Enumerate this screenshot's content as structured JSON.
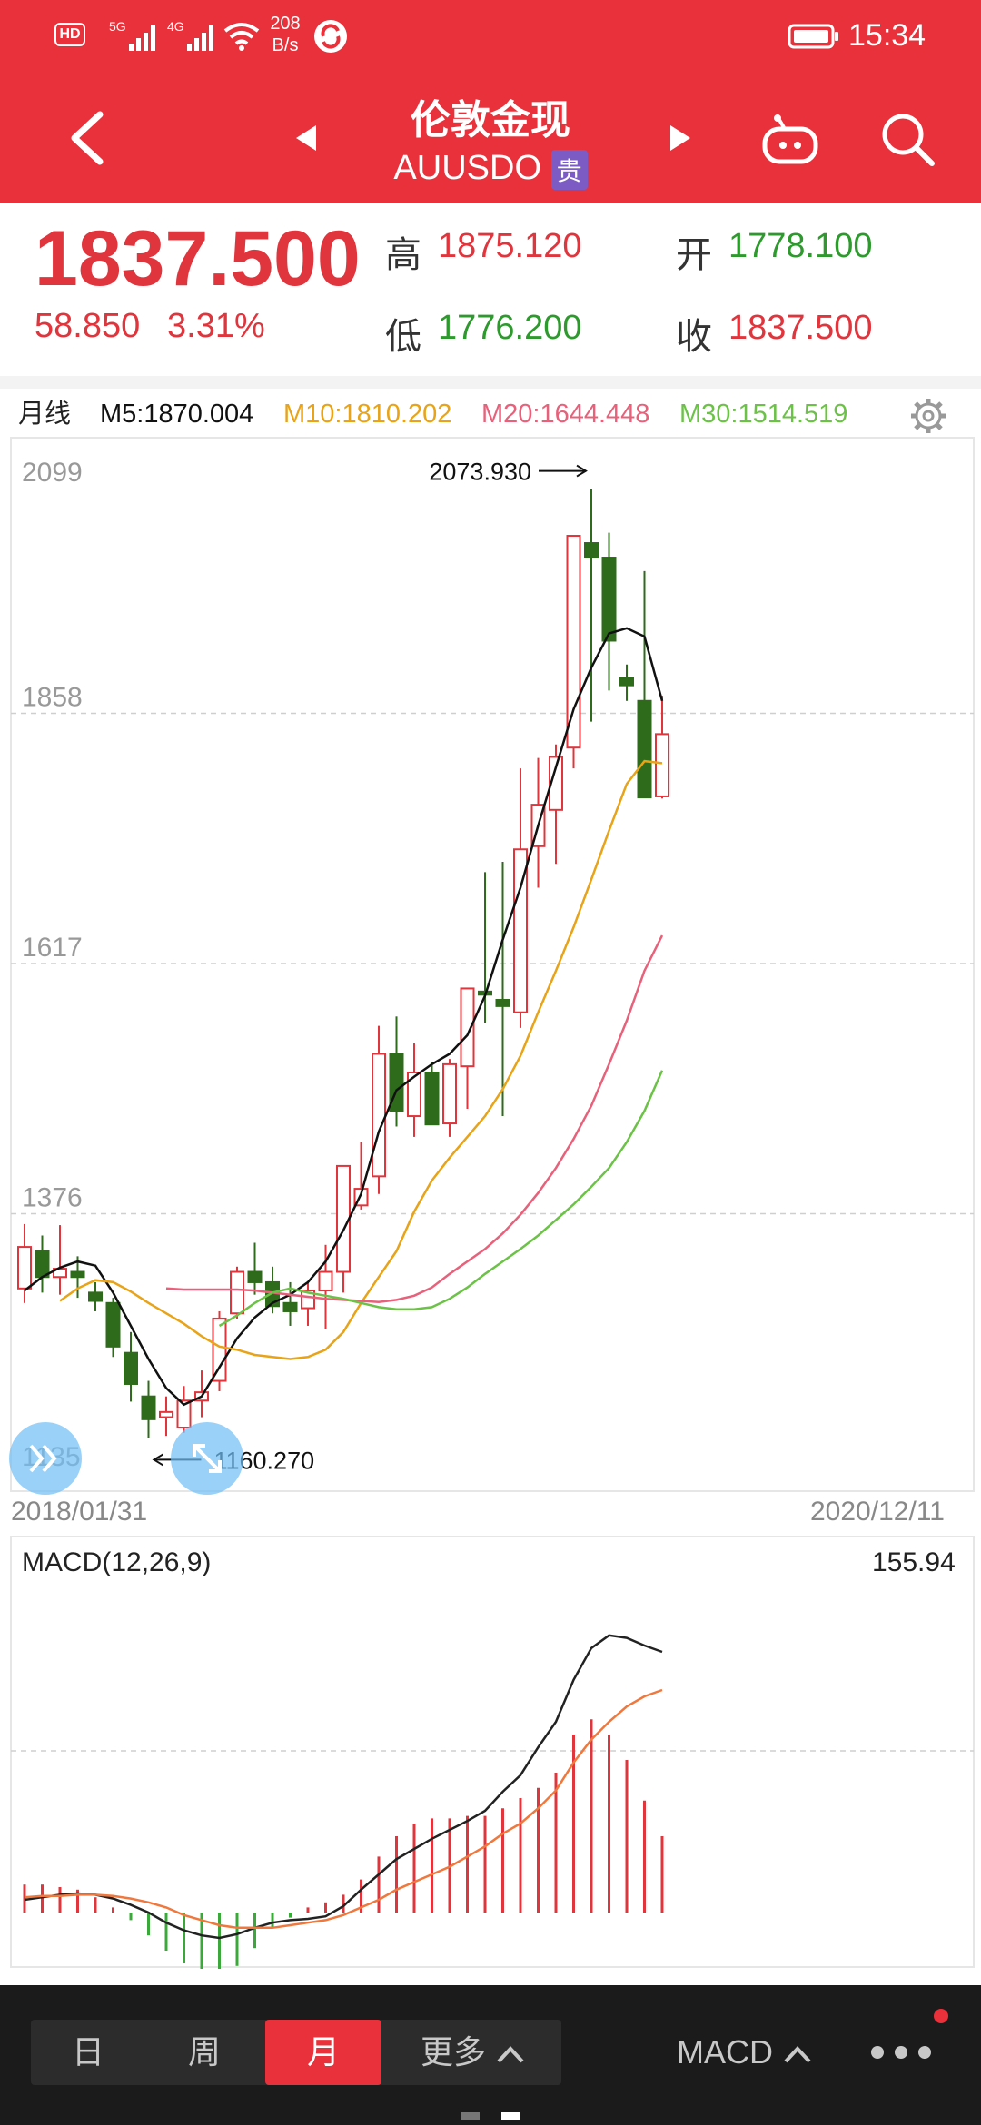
{
  "status_bar": {
    "left_icons": [
      "hd-icon",
      "signal-5g-icon",
      "signal-4g-icon",
      "wifi-icon"
    ],
    "speed_value": "208",
    "speed_unit": "B/s",
    "time": "15:34"
  },
  "header": {
    "title": "伦敦金现",
    "symbol": "AUUSDO",
    "badge": "贵"
  },
  "quote": {
    "price": "1837.500",
    "change": "58.850",
    "change_pct": "3.31%",
    "high_label": "高",
    "high": "1875.120",
    "open_label": "开",
    "open": "1778.100",
    "low_label": "低",
    "low": "1776.200",
    "close_label": "收",
    "close": "1837.500"
  },
  "indicators": {
    "period": "月线",
    "m5": "M5:1870.004",
    "m10": "M10:1810.202",
    "m20": "M20:1644.448",
    "m30": "M30:1514.519"
  },
  "colors": {
    "up": "#e0353d",
    "down": "#2e6b1a",
    "m5": "#111111",
    "m10": "#e8a317",
    "m20": "#e8617a",
    "m30": "#6cc247",
    "dif": "#222222",
    "dea": "#f0783c",
    "header": "#e8313a"
  },
  "chart_data": [
    {
      "type": "candlestick",
      "title": "月线",
      "x_start": "2018/01/31",
      "x_end": "2020/12/11",
      "y_ticks": [
        "2099",
        "1858",
        "1617",
        "1376",
        "1135"
      ],
      "ylim": [
        1135,
        2099
      ],
      "annotations": {
        "max_label": "2073.930",
        "min_label": "1160.270"
      },
      "candles": [
        {
          "o": 1304,
          "h": 1366,
          "l": 1290,
          "c": 1344
        },
        {
          "o": 1340,
          "h": 1355,
          "l": 1300,
          "c": 1315
        },
        {
          "o": 1315,
          "h": 1365,
          "l": 1298,
          "c": 1323
        },
        {
          "o": 1320,
          "h": 1335,
          "l": 1295,
          "c": 1315
        },
        {
          "o": 1300,
          "h": 1310,
          "l": 1282,
          "c": 1292
        },
        {
          "o": 1290,
          "h": 1295,
          "l": 1238,
          "c": 1248
        },
        {
          "o": 1242,
          "h": 1262,
          "l": 1195,
          "c": 1212
        },
        {
          "o": 1200,
          "h": 1215,
          "l": 1160,
          "c": 1178
        },
        {
          "o": 1180,
          "h": 1200,
          "l": 1162,
          "c": 1185
        },
        {
          "o": 1170,
          "h": 1210,
          "l": 1165,
          "c": 1196
        },
        {
          "o": 1196,
          "h": 1225,
          "l": 1180,
          "c": 1204
        },
        {
          "o": 1215,
          "h": 1282,
          "l": 1205,
          "c": 1275
        },
        {
          "o": 1280,
          "h": 1325,
          "l": 1275,
          "c": 1320
        },
        {
          "o": 1320,
          "h": 1348,
          "l": 1298,
          "c": 1310
        },
        {
          "o": 1310,
          "h": 1325,
          "l": 1280,
          "c": 1287
        },
        {
          "o": 1290,
          "h": 1310,
          "l": 1268,
          "c": 1282
        },
        {
          "o": 1285,
          "h": 1310,
          "l": 1268,
          "c": 1302
        },
        {
          "o": 1302,
          "h": 1346,
          "l": 1265,
          "c": 1320
        },
        {
          "o": 1320,
          "h": 1418,
          "l": 1300,
          "c": 1422
        },
        {
          "o": 1384,
          "h": 1445,
          "l": 1380,
          "c": 1400
        },
        {
          "o": 1412,
          "h": 1557,
          "l": 1395,
          "c": 1530
        },
        {
          "o": 1530,
          "h": 1566,
          "l": 1460,
          "c": 1475
        },
        {
          "o": 1470,
          "h": 1540,
          "l": 1450,
          "c": 1512
        },
        {
          "o": 1512,
          "h": 1522,
          "l": 1465,
          "c": 1462
        },
        {
          "o": 1463,
          "h": 1525,
          "l": 1450,
          "c": 1520
        },
        {
          "o": 1518,
          "h": 1590,
          "l": 1477,
          "c": 1593
        },
        {
          "o": 1590,
          "h": 1705,
          "l": 1560,
          "c": 1587
        },
        {
          "o": 1582,
          "h": 1715,
          "l": 1470,
          "c": 1576
        },
        {
          "o": 1570,
          "h": 1805,
          "l": 1555,
          "c": 1727
        },
        {
          "o": 1730,
          "h": 1815,
          "l": 1690,
          "c": 1770
        },
        {
          "o": 1765,
          "h": 1828,
          "l": 1713,
          "c": 1816
        },
        {
          "o": 1825,
          "h": 1962,
          "l": 1805,
          "c": 2029
        },
        {
          "o": 2022,
          "h": 2074,
          "l": 1850,
          "c": 2008
        },
        {
          "o": 2008,
          "h": 2032,
          "l": 1880,
          "c": 1928
        },
        {
          "o": 1892,
          "h": 1905,
          "l": 1870,
          "c": 1885
        },
        {
          "o": 1870,
          "h": 1995,
          "l": 1823,
          "c": 1777
        },
        {
          "o": 1778,
          "h": 1875,
          "l": 1776,
          "c": 1838
        }
      ],
      "ma": {
        "M5": [
          1302,
          1315,
          1324,
          1330,
          1326,
          1300,
          1268,
          1236,
          1208,
          1192,
          1200,
          1228,
          1256,
          1276,
          1290,
          1298,
          1310,
          1330,
          1360,
          1395,
          1455,
          1495,
          1508,
          1520,
          1530,
          1548,
          1586,
          1640,
          1690,
          1750,
          1806,
          1862,
          1902,
          1935,
          1940,
          1932,
          1870
        ],
        "M10": [
          1292,
          1304,
          1312,
          1310,
          1301,
          1290,
          1280,
          1270,
          1258,
          1248,
          1245,
          1240,
          1238,
          1236,
          1238,
          1245,
          1262,
          1290,
          1315,
          1340,
          1378,
          1408,
          1430,
          1450,
          1470,
          1496,
          1528,
          1570,
          1610,
          1652,
          1698,
          1745,
          1790,
          1812,
          1810
        ],
        "M20": [
          1304,
          1303,
          1303,
          1303,
          1303,
          1302,
          1300,
          1298,
          1296,
          1294,
          1293,
          1292,
          1291,
          1293,
          1297,
          1305,
          1318,
          1330,
          1342,
          1357,
          1375,
          1396,
          1420,
          1448,
          1480,
          1520,
          1562,
          1610,
          1644
        ],
        "M30": [
          1268,
          1278,
          1290,
          1300,
          1304,
          1300,
          1297,
          1294,
          1290,
          1286,
          1284,
          1284,
          1286,
          1294,
          1305,
          1318,
          1330,
          1342,
          1355,
          1370,
          1385,
          1402,
          1420,
          1445,
          1475,
          1514
        ]
      }
    },
    {
      "type": "macd",
      "title": "MACD(12,26,9)",
      "value_label": "155.94",
      "dif": [
        10,
        12,
        14,
        15,
        14,
        11,
        6,
        0,
        -8,
        -14,
        -18,
        -20,
        -17,
        -12,
        -8,
        -6,
        -5,
        -3,
        5,
        18,
        30,
        42,
        50,
        58,
        65,
        72,
        80,
        95,
        108,
        130,
        150,
        183,
        208,
        218,
        216,
        210,
        205
      ],
      "dea": [
        12,
        13,
        13,
        14,
        14,
        13,
        11,
        8,
        4,
        -2,
        -6,
        -10,
        -12,
        -12,
        -12,
        -10,
        -8,
        -6,
        -2,
        4,
        10,
        18,
        24,
        30,
        36,
        44,
        52,
        62,
        70,
        82,
        96,
        118,
        136,
        150,
        162,
        170,
        175
      ],
      "hist": [
        22,
        22,
        20,
        18,
        12,
        4,
        -6,
        -18,
        -30,
        -40,
        -48,
        -50,
        -42,
        -28,
        -12,
        -4,
        4,
        8,
        14,
        26,
        44,
        60,
        70,
        74,
        74,
        76,
        76,
        82,
        90,
        98,
        110,
        140,
        152,
        140,
        120,
        88,
        60
      ]
    }
  ],
  "chart_settings_icon": "gear-icon",
  "bottom": {
    "tabs": [
      "日",
      "周",
      "月",
      "更多"
    ],
    "active": "月",
    "indicator": "MACD"
  }
}
